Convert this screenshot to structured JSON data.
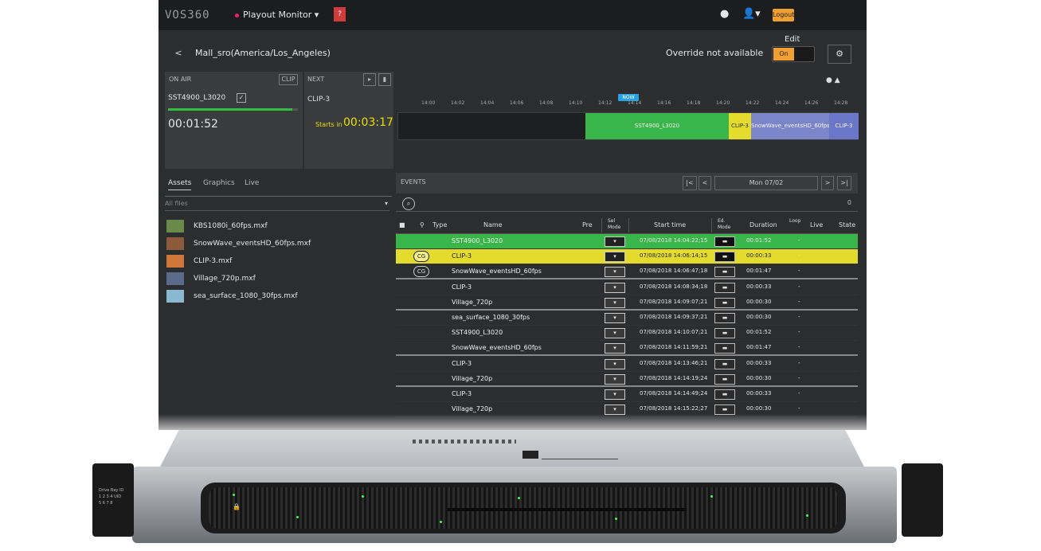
{
  "topbar": {
    "logo": "VOS360",
    "playout_label": "Playout Monitor",
    "red_badge": "?",
    "help_icon": "help-icon",
    "user_icon": "user-icon",
    "orange_badge": "Logout"
  },
  "header": {
    "back_label": "<",
    "playlist_name": "Mall_sro(America/Los_Angeles)",
    "override_label": "Override not available",
    "edit_label": "Edit",
    "edit_toggle": "On",
    "gear_label": "⚙"
  },
  "on_air": {
    "title": "ON AIR",
    "mini_btn": "CLIP",
    "clip": "SST4900_L3020",
    "check": "✓",
    "progress_pct": 96,
    "time": "00:01:52"
  },
  "next": {
    "title": "NEXT",
    "clip": "CLIP-3",
    "starts_in_label": "Starts in",
    "time": "00:03:17"
  },
  "timeline": {
    "now_label": "NOW",
    "ticks": [
      "14:00",
      "14:02",
      "14:04",
      "14:06",
      "14:08",
      "14:10",
      "14:12",
      "14:14",
      "14:16",
      "14:18",
      "14:20",
      "14:22",
      "14:24",
      "14:26",
      "14:28"
    ],
    "blocks": [
      {
        "label": "",
        "color": "#1e1f20"
      },
      {
        "label": "SST4900_L3020",
        "color": "#39b54a"
      },
      {
        "label": "CLIP-3",
        "color": "#e3dc2c"
      },
      {
        "label": "SnowWave_eventsHD_60fps",
        "color": "#7b86c9"
      },
      {
        "label": "CLIP-3",
        "color": "#6b78c9"
      }
    ]
  },
  "assets": {
    "tabs": [
      "Assets",
      "Graphics",
      "Live"
    ],
    "filter_placeholder": "All files",
    "items": [
      {
        "name": "KBS1080i_60fps.mxf",
        "color": "#6a8a4a"
      },
      {
        "name": "SnowWave_eventsHD_60fps.mxf",
        "color": "#8a5a3a"
      },
      {
        "name": "CLIP-3.mxf",
        "color": "#d0783a"
      },
      {
        "name": "Village_720p.mxf",
        "color": "#5a6a8a"
      },
      {
        "name": "sea_surface_1080_30fps.mxf",
        "color": "#8ab8d0"
      }
    ]
  },
  "playlist": {
    "title": "EVENTS",
    "nav_first": "|<",
    "nav_prev": "<",
    "date": "Mon 07/02",
    "nav_next": ">",
    "nav_last": ">|",
    "search_icon": "search-icon",
    "count": "0",
    "columns": [
      "Type",
      "Name",
      "Pre",
      "Sel Mode",
      "Start time",
      "Ed. Mode",
      "Duration",
      "Loop",
      "Live",
      "State"
    ],
    "rows": [
      {
        "style": "green",
        "badge": "",
        "name": "SST4900_L3020",
        "sel": "▾",
        "start": "07/08/2018 14:04:22;15",
        "ed": "▬",
        "duration": "00:01:52",
        "dash": "-"
      },
      {
        "style": "yellow",
        "badge": "CG",
        "name": "CLIP-3",
        "sel": "▾",
        "start": "07/08/2018 14:06:14;15",
        "ed": "▬",
        "duration": "00:00:33",
        "dash": "-"
      },
      {
        "style": "sep",
        "badge": "CG",
        "name": "SnowWave_eventsHD_60fps",
        "sel": "▾",
        "start": "07/08/2018 14:06:47;18",
        "ed": "▬",
        "duration": "00:01:47",
        "dash": "-"
      },
      {
        "style": "",
        "badge": "",
        "name": "CLIP-3",
        "sel": "▾",
        "start": "07/08/2018 14:08:34;18",
        "ed": "▬",
        "duration": "00:00:33",
        "dash": "-"
      },
      {
        "style": "sep",
        "badge": "",
        "name": "Village_720p",
        "sel": "▾",
        "start": "07/08/2018 14:09:07;21",
        "ed": "▬",
        "duration": "00:00:30",
        "dash": "-"
      },
      {
        "style": "",
        "badge": "",
        "name": "sea_surface_1080_30fps",
        "sel": "▾",
        "start": "07/08/2018 14:09:37;21",
        "ed": "▬",
        "duration": "00:00:30",
        "dash": "-"
      },
      {
        "style": "",
        "badge": "",
        "name": "SST4900_L3020",
        "sel": "▾",
        "start": "07/08/2018 14:10:07;21",
        "ed": "▬",
        "duration": "00:01:52",
        "dash": "-"
      },
      {
        "style": "sep",
        "badge": "",
        "name": "SnowWave_eventsHD_60fps",
        "sel": "▾",
        "start": "07/08/2018 14:11:59;21",
        "ed": "▬",
        "duration": "00:01:47",
        "dash": "-"
      },
      {
        "style": "",
        "badge": "",
        "name": "CLIP-3",
        "sel": "▾",
        "start": "07/08/2018 14:13:46;21",
        "ed": "▬",
        "duration": "00:00:33",
        "dash": "-"
      },
      {
        "style": "sep",
        "badge": "",
        "name": "Village_720p",
        "sel": "▾",
        "start": "07/08/2018 14:14:19;24",
        "ed": "▬",
        "duration": "00:00:30",
        "dash": "-"
      },
      {
        "style": "",
        "badge": "",
        "name": "CLIP-3",
        "sel": "▾",
        "start": "07/08/2018 14:14:49;24",
        "ed": "▬",
        "duration": "00:00:33",
        "dash": "-"
      },
      {
        "style": "",
        "badge": "",
        "name": "Village_720p",
        "sel": "▾",
        "start": "07/08/2018 14:15:22;27",
        "ed": "▬",
        "duration": "00:00:30",
        "dash": "-"
      }
    ]
  },
  "server": {
    "drive_bay_label": "Drive Bay ID",
    "bay_numbers_top": "1 2 3 4 UID",
    "bay_numbers_bottom": "5 6 7 8",
    "lock_icon": "lock-icon"
  }
}
